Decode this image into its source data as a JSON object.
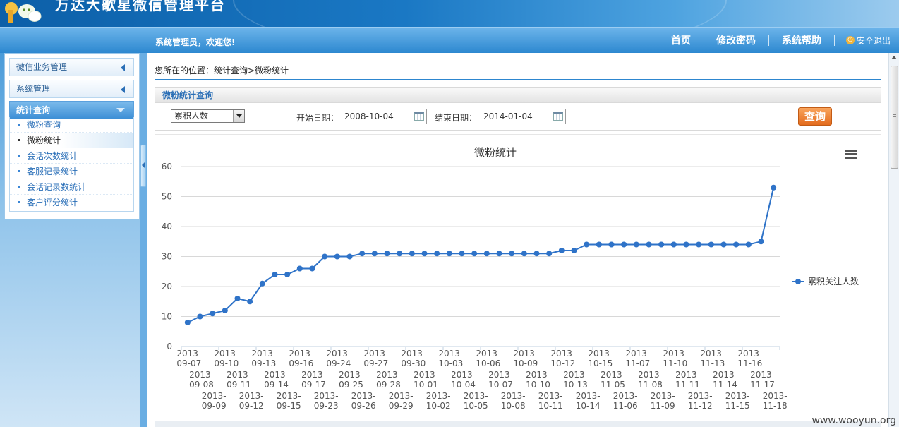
{
  "app": {
    "title": "万达大歌星微信管理平台",
    "welcome": "系统管理员，欢迎您!"
  },
  "nav": {
    "home": "首页",
    "change_password": "修改密码",
    "help": "系统帮助",
    "logout": "安全退出"
  },
  "sidebar": {
    "groups": [
      {
        "label": "微信业务管理",
        "expanded": false
      },
      {
        "label": "系统管理",
        "expanded": false
      },
      {
        "label": "统计查询",
        "expanded": true
      }
    ],
    "items": [
      {
        "label": "微粉查询"
      },
      {
        "label": "微粉统计",
        "current": true
      },
      {
        "label": "会话次数统计"
      },
      {
        "label": "客服记录统计"
      },
      {
        "label": "会话记录数统计"
      },
      {
        "label": "客户评分统计"
      }
    ]
  },
  "breadcrumb": "您所在的位置：统计查询>微粉统计",
  "query": {
    "title": "微粉统计查询",
    "select_value": "累积人数",
    "start_label": "开始日期：",
    "start_value": "2008-10-04",
    "end_label": "结束日期：",
    "end_value": "2014-01-04",
    "button": "查询"
  },
  "colors": {
    "line": "#2f73c8",
    "accent": "#2d86cf",
    "button": "#e36b1d"
  },
  "chart_data": {
    "type": "line",
    "title": "微粉统计",
    "ylim": [
      0,
      60
    ],
    "yticks": [
      0,
      10,
      20,
      30,
      40,
      50,
      60
    ],
    "grid": true,
    "legend_position": "right",
    "menu_icon": "hamburger-icon",
    "x": [
      "2013-09-07",
      "2013-09-08",
      "2013-09-09",
      "2013-09-10",
      "2013-09-11",
      "2013-09-12",
      "2013-09-13",
      "2013-09-14",
      "2013-09-15",
      "2013-09-16",
      "2013-09-17",
      "2013-09-23",
      "2013-09-24",
      "2013-09-25",
      "2013-09-26",
      "2013-09-27",
      "2013-09-28",
      "2013-09-29",
      "2013-09-30",
      "2013-10-01",
      "2013-10-02",
      "2013-10-03",
      "2013-10-04",
      "2013-10-05",
      "2013-10-06",
      "2013-10-07",
      "2013-10-08",
      "2013-10-09",
      "2013-10-10",
      "2013-10-11",
      "2013-10-12",
      "2013-10-13",
      "2013-10-14",
      "2013-10-15",
      "2013-11-05",
      "2013-11-06",
      "2013-11-07",
      "2013-11-08",
      "2013-11-09",
      "2013-11-10",
      "2013-11-11",
      "2013-11-12",
      "2013-11-13",
      "2013-11-14",
      "2013-11-15",
      "2013-11-16",
      "2013-11-17",
      "2013-11-18"
    ],
    "series": [
      {
        "name": "累积关注人数",
        "values": [
          8,
          10,
          11,
          12,
          16,
          15,
          21,
          24,
          24,
          26,
          26,
          30,
          30,
          30,
          31,
          31,
          31,
          31,
          31,
          31,
          31,
          31,
          31,
          31,
          31,
          31,
          31,
          31,
          31,
          31,
          32,
          32,
          34,
          34,
          34,
          34,
          34,
          34,
          34,
          34,
          34,
          34,
          34,
          34,
          34,
          34,
          35,
          53
        ]
      }
    ]
  }
}
